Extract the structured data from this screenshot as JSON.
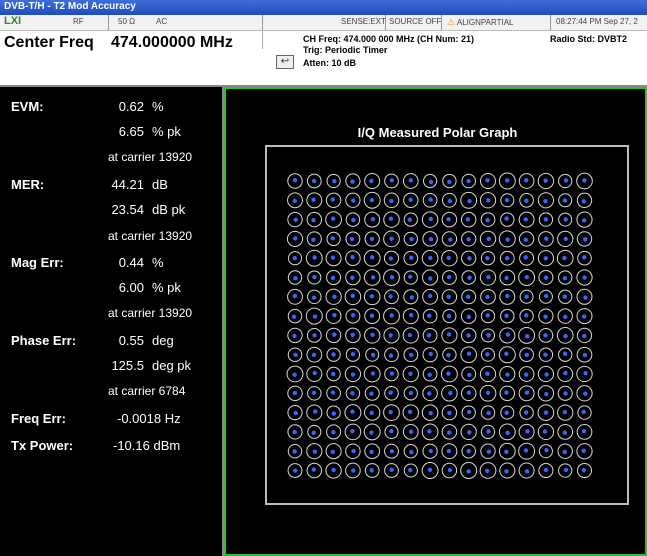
{
  "window": {
    "title": "DVB-T/H - T2 Mod Accuracy"
  },
  "status": {
    "x_label": "LXI",
    "rf": "RF",
    "impedance": "50 Ω",
    "coupling": "AC",
    "sense": "SENSE:EXT",
    "source": "SOURCE OFF",
    "align": "ALIGNPARTIAL",
    "time": "08:27:44 PM Sep 27, 2"
  },
  "meter": {
    "center_freq_label": "Center Freq",
    "center_freq_value": "474.000000 MHz",
    "ch_freq": "CH Freq: 474.000 000 MHz (CH Num: 21)",
    "radio_std": "Radio Std: DVBT2",
    "trig": "Trig: Periodic Timer",
    "atten": "Atten: 10 dB"
  },
  "results": {
    "evm_label": "EVM:",
    "evm_value": "0.62",
    "evm_unit": "%",
    "evm_pk_value": "6.65",
    "evm_pk_unit": "% pk",
    "evm_carrier": "at carrier 13920",
    "mer_label": "MER:",
    "mer_value": "44.21",
    "mer_unit": "dB",
    "mer_pk_value": "23.54",
    "mer_pk_unit": "dB pk",
    "mer_carrier": "at carrier 13920",
    "mag_label": "Mag Err:",
    "mag_value": "0.44",
    "mag_unit": "%",
    "mag_pk_value": "6.00",
    "mag_pk_unit": "% pk",
    "mag_carrier": "at carrier 13920",
    "phase_label": "Phase Err:",
    "phase_value": "0.55",
    "phase_unit": "deg",
    "phase_pk_value": "125.5",
    "phase_pk_unit": "deg pk",
    "phase_carrier": "at carrier 6784",
    "freq_label": "Freq Err:",
    "freq_value": "-0.0018 Hz",
    "tx_label": "Tx Power:",
    "tx_value": "-10.16 dBm"
  },
  "graph": {
    "title": "I/Q Measured Polar Graph",
    "grid_size": 16,
    "colors": {
      "ring": "#d8d8d8",
      "dot": "#3a64ff",
      "accent": "#2fbf2f"
    }
  }
}
